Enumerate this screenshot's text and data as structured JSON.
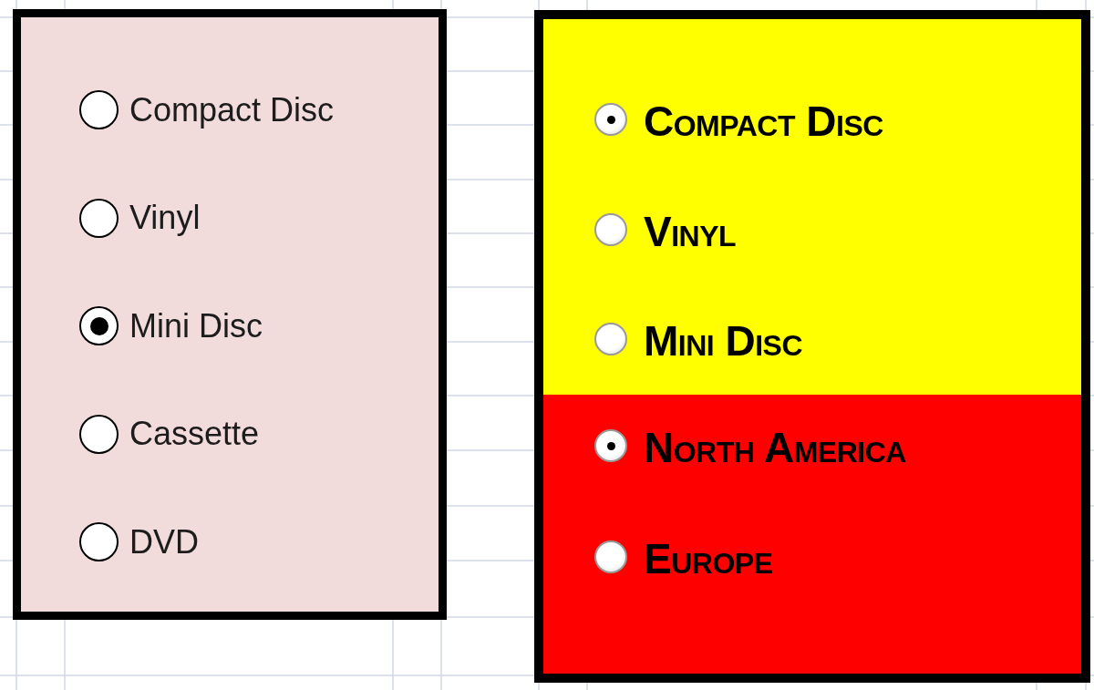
{
  "frames": [
    {
      "kind": "classic",
      "panels": [
        {
          "color": "#f2dcdb",
          "options": [
            {
              "label": "Compact Disc",
              "selected": false
            },
            {
              "label": "Vinyl",
              "selected": false
            },
            {
              "label": "Mini Disc",
              "selected": true
            },
            {
              "label": "Cassette",
              "selected": false
            },
            {
              "label": "DVD",
              "selected": false
            }
          ]
        }
      ]
    },
    {
      "kind": "styled",
      "panels": [
        {
          "color": "#ffff00",
          "options": [
            {
              "label": "Compact Disc",
              "selected": true
            },
            {
              "label": "Vinyl",
              "selected": false
            },
            {
              "label": "Mini Disc",
              "selected": false
            }
          ]
        },
        {
          "color": "#ff0000",
          "options": [
            {
              "label": "North America",
              "selected": true
            },
            {
              "label": "Europe",
              "selected": false
            }
          ]
        }
      ]
    }
  ]
}
